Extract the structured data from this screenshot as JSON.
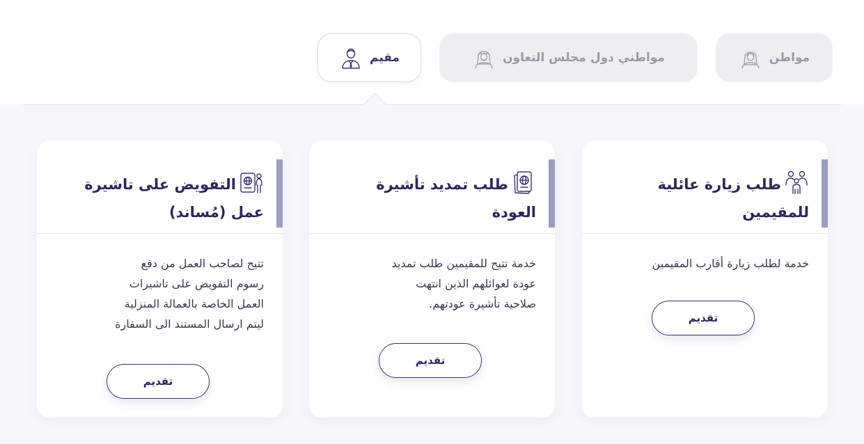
{
  "tabs": [
    {
      "label": "مواطن",
      "icon": "citizen-icon",
      "active": false
    },
    {
      "label": "مواطني دول مجلس التعاون",
      "icon": "gcc-citizen-icon",
      "active": false
    },
    {
      "label": "مقيم",
      "icon": "resident-icon",
      "active": true
    }
  ],
  "cards": [
    {
      "title": "طلب زيارة عائلية للمقيمين",
      "icon": "family-icon",
      "description": "خدمة لطلب زيارة أقارب المقيمين",
      "button": "تقديم"
    },
    {
      "title": "طلب تمديد تأشيرة العودة",
      "icon": "passport-icon",
      "description": "خدمة تتيح للمقيمين طلب تمديد\nعودة لعوائلهم الذين انتهت\nصلاحية تأشيرة عودتهم.",
      "button": "تقديم"
    },
    {
      "title": "التفويض على تاشيرة عمل (مُساند)",
      "icon": "work-visa-icon",
      "description": "تتيح لصاحب العمل من دفع\nرسوم التفويض على تاشيرات\nالعمل الخاصة بالعمالة المنزلية\nليتم ارسال المستند الى السفارة",
      "button": "تقديم"
    }
  ],
  "colors": {
    "primary": "#2d275f",
    "accent_bar": "#9d9cc2",
    "tab_inactive_bg": "#eeeef1",
    "tab_inactive_text": "#9a9aa6"
  }
}
